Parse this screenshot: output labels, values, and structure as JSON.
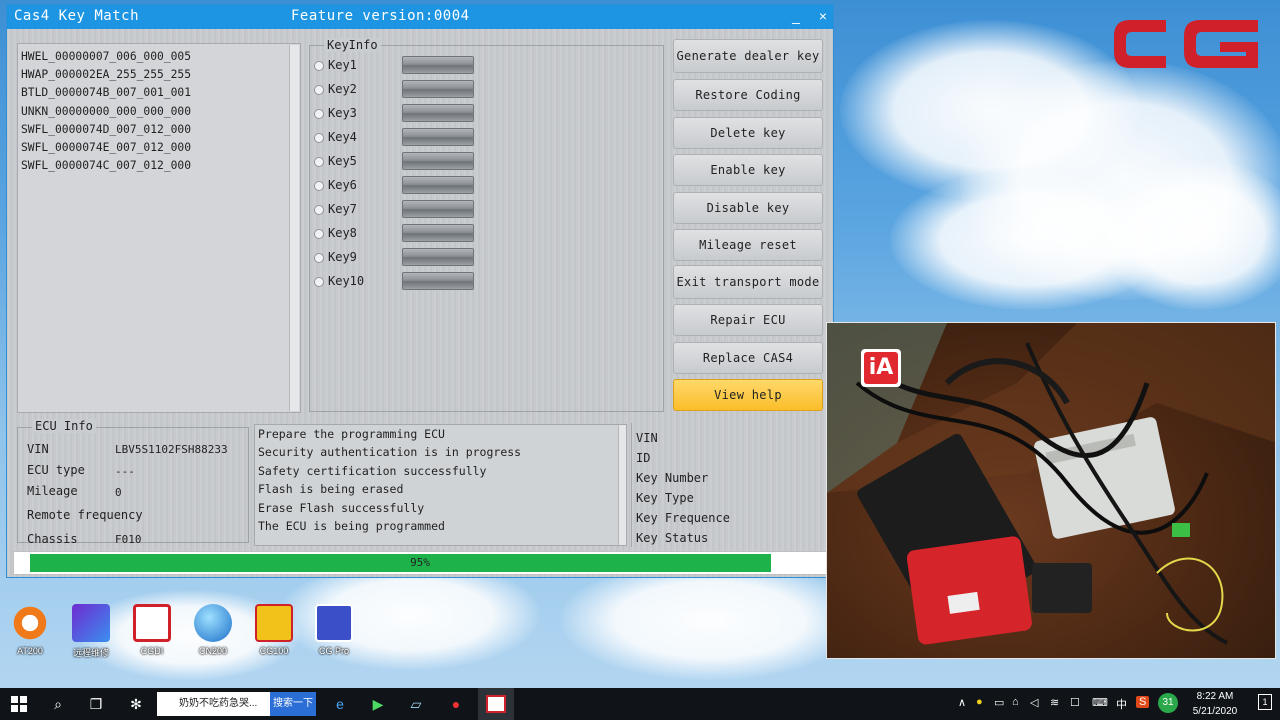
{
  "window": {
    "title": "Cas4 Key Match",
    "feature_version": "Feature version:0004",
    "minimize": "_",
    "close": "×"
  },
  "ecu_list": [
    "HWEL_00000007_006_000_005",
    "HWAP_000002EA_255_255_255",
    "BTLD_0000074B_007_001_001",
    "UNKN_00000000_000_000_000",
    "SWFL_0000074D_007_012_000",
    "SWFL_0000074E_007_012_000",
    "SWFL_0000074C_007_012_000"
  ],
  "keyinfo": {
    "legend": "KeyInfo",
    "keys": [
      "Key1",
      "Key2",
      "Key3",
      "Key4",
      "Key5",
      "Key6",
      "Key7",
      "Key8",
      "Key9",
      "Key10"
    ]
  },
  "buttons": {
    "generate_dealer_key": "Generate dealer key",
    "restore_coding": "Restore Coding",
    "delete_key": "Delete key",
    "enable_key": "Enable key",
    "disable_key": "Disable key",
    "mileage_reset": "Mileage reset",
    "exit_transport_mode": "Exit transport mode",
    "repair_ecu": "Repair ECU",
    "replace_cas4": "Replace CAS4",
    "view_help": "View help"
  },
  "ecu_info": {
    "legend": "ECU Info",
    "vin_label": "VIN",
    "vin_value": "LBV5S1102FSH88233",
    "ecu_type_label": "ECU type",
    "ecu_type_value": "---",
    "mileage_label": "Mileage",
    "mileage_value": "0",
    "remote_frequency_label": "Remote frequency",
    "chassis_label": "Chassis",
    "chassis_value": "F010"
  },
  "log": [
    "Prepare the programming ECU",
    "Security authentication is in progress",
    "Safety certification successfully",
    "Flash is being erased",
    "Erase Flash successfully",
    "The ECU is being programmed"
  ],
  "key_details": {
    "vin": "VIN",
    "id": "ID",
    "key_number": "Key Number",
    "key_type": "Key Type",
    "key_frequence": "Key Frequence",
    "key_status": "Key Status"
  },
  "progress": {
    "percent": 95,
    "label": "95%"
  },
  "brand": {
    "logo_color": "#d0212a",
    "accent": "#1d95e2",
    "progress_color": "#1db24a",
    "help_button_color": "#fbbe2b"
  },
  "desktop_icons": [
    {
      "label": "AT200",
      "icon": "at200-icon"
    },
    {
      "label": "远程维修",
      "icon": "remote-repair-icon"
    },
    {
      "label": "CGDI",
      "icon": "cgdi-icon"
    },
    {
      "label": "CN200",
      "icon": "cn200-icon"
    },
    {
      "label": "CG100",
      "icon": "cg100-icon"
    },
    {
      "label": "CG Pro",
      "icon": "cgpro-icon"
    }
  ],
  "taskbar": {
    "browser_tab": "奶奶不吃药急哭...",
    "search_button": "搜索一下",
    "ime": "中",
    "time": "8:22 AM",
    "date": "5/21/2020",
    "badge": "31",
    "notification_count": "1"
  }
}
